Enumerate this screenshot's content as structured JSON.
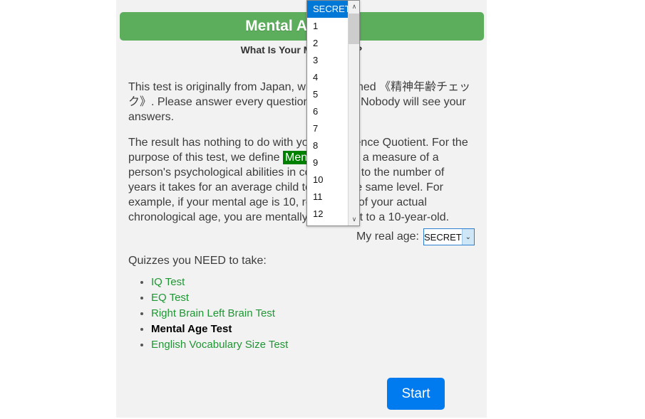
{
  "header": {
    "title": "Mental Age Test",
    "subtitle": "What Is Your Mental Age?",
    "bar_color": "#5cad5c"
  },
  "body": {
    "paragraph_1_before": "This test is originally from Japan, which is named ",
    "paragraph_1_jp": "《精神年齢チェック》",
    "paragraph_1_after": ". Please answer every question honestly. Nobody will see your answers.",
    "paragraph_2_before": "The result has nothing to do with your Intelligence Quotient. For the purpose of this test, we define ",
    "paragraph_2_highlight": "Mental Age",
    "paragraph_2_after": " as a measure of a person's psychological abilities in comparison to the number of years it takes for an average child to reach the same level. For example, if your mental age is 10, regardless of your actual chronological age, you are mentally equivalent to a 10-year-old."
  },
  "age_field": {
    "label": "My real age:",
    "selected_value": "SECRET",
    "arrow_glyph": "⌄"
  },
  "dropdown": {
    "open": true,
    "highlight_color": "#0078d7",
    "options": [
      "SECRET",
      "1",
      "2",
      "3",
      "4",
      "5",
      "6",
      "7",
      "8",
      "9",
      "10",
      "11",
      "12"
    ],
    "selected_index": 0,
    "scrollbar": {
      "up_arrow": "∧",
      "down_arrow": "∨"
    }
  },
  "quizzes": {
    "heading": "Quizzes you NEED to take:",
    "items": [
      {
        "label": "IQ Test",
        "current": false
      },
      {
        "label": "EQ Test",
        "current": false
      },
      {
        "label": "Right Brain Left Brain Test",
        "current": false
      },
      {
        "label": "Mental Age Test",
        "current": true
      },
      {
        "label": "English Vocabulary Size Test",
        "current": false
      }
    ],
    "link_color": "#1e9633"
  },
  "start": {
    "label": "Start",
    "color": "#007bef"
  }
}
